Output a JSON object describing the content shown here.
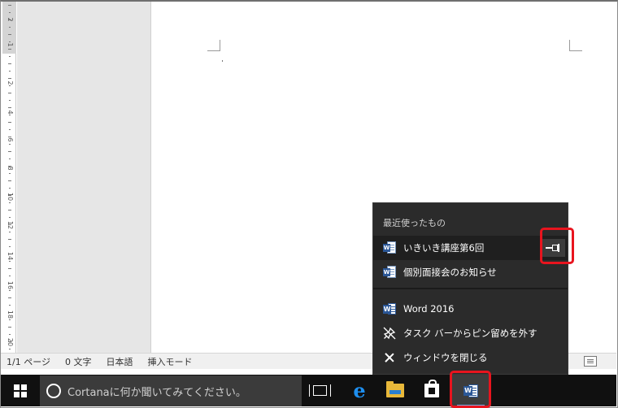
{
  "ruler": {
    "numbers": [
      "2",
      "1",
      "2",
      "4",
      "6",
      "8",
      "10",
      "12",
      "14",
      "16",
      "18",
      "20"
    ]
  },
  "status_bar": {
    "page": "1/1 ページ",
    "chars": "0 文字",
    "language": "日本語",
    "mode": "挿入モード"
  },
  "taskbar": {
    "search_placeholder": "Cortanaに何か聞いてみてください。",
    "word_icon_letter": "W",
    "edge_glyph": "e"
  },
  "jumplist": {
    "recent_heading": "最近使ったもの",
    "recent_items": [
      {
        "label": "いきいき講座第6回",
        "icon": "word-document-icon"
      },
      {
        "label": "個別面接会のお知らせ",
        "icon": "word-document-icon"
      }
    ],
    "app_name": "Word 2016",
    "unpin_label": "タスク バーからピン留めを外す",
    "close_label": "ウィンドウを閉じる"
  },
  "colors": {
    "highlight": "#e8141e",
    "word_blue": "#2b5797",
    "edge_blue": "#1e8ff0",
    "taskbar": "#101010",
    "jumplist_bg": "#2b2b2b"
  }
}
